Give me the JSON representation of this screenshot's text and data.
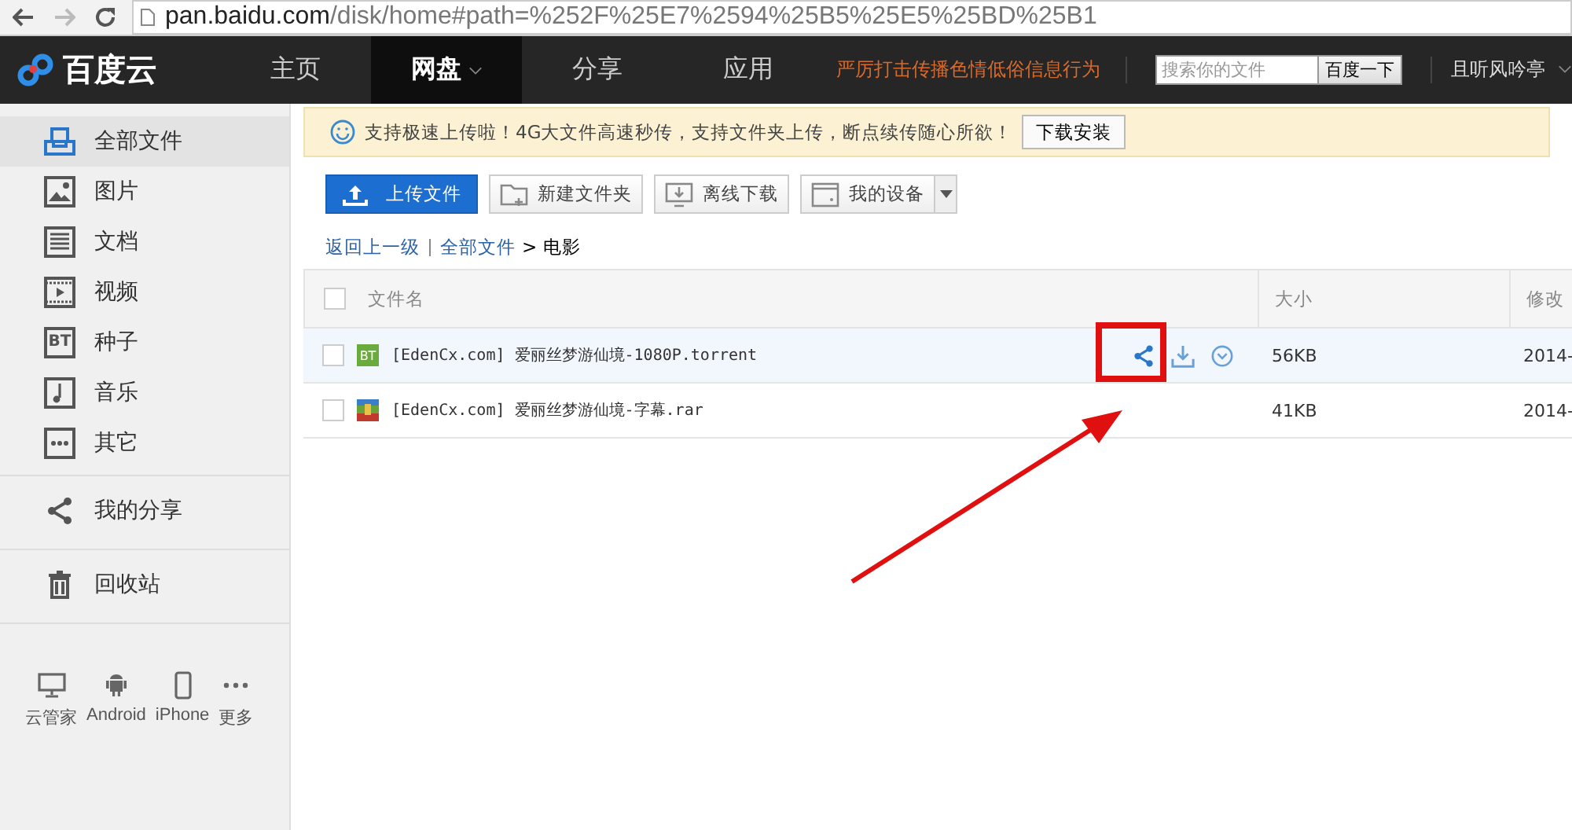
{
  "browser": {
    "url_host": "pan.baidu.com",
    "url_rest": "/disk/home#path=%252F%25E7%2594%25B5%25E5%25BD%25B1"
  },
  "nav": {
    "logo": "百度云",
    "items": [
      {
        "label": "主页",
        "selected": false,
        "has_caret": false
      },
      {
        "label": "网盘",
        "selected": true,
        "has_caret": true
      },
      {
        "label": "分享",
        "selected": false,
        "has_caret": false
      },
      {
        "label": "应用",
        "selected": false,
        "has_caret": false
      }
    ],
    "notice": "严厉打击传播色情低俗信息行为",
    "search": {
      "placeholder": "搜索你的文件",
      "button": "百度一下"
    },
    "user": "且听风吟亭"
  },
  "sidebar": {
    "items": [
      {
        "kind": "all",
        "label": "全部文件",
        "selected": true
      },
      {
        "kind": "image",
        "label": "图片",
        "selected": false
      },
      {
        "kind": "doc",
        "label": "文档",
        "selected": false
      },
      {
        "kind": "video",
        "label": "视频",
        "selected": false
      },
      {
        "kind": "bt",
        "label": "种子",
        "selected": false,
        "icon_text": "BT"
      },
      {
        "kind": "music",
        "label": "音乐",
        "selected": false
      },
      {
        "kind": "other",
        "label": "其它",
        "selected": false
      }
    ],
    "extra": [
      {
        "kind": "share",
        "label": "我的分享"
      },
      {
        "kind": "trash",
        "label": "回收站"
      }
    ],
    "devices": [
      {
        "kind": "pc",
        "label": "云管家"
      },
      {
        "kind": "android",
        "label": "Android"
      },
      {
        "kind": "phone",
        "label": "iPhone"
      },
      {
        "kind": "more",
        "label": "更多"
      }
    ]
  },
  "banner": {
    "text": "支持极速上传啦！4G大文件高速秒传，支持文件夹上传，断点续传随心所欲！",
    "button": "下载安装"
  },
  "toolbar": [
    {
      "kind": "upload",
      "label": "上传文件"
    },
    {
      "kind": "folder",
      "label": "新建文件夹"
    },
    {
      "kind": "offline",
      "label": "离线下载"
    },
    {
      "kind": "device",
      "label": "我的设备"
    }
  ],
  "breadcrumb": {
    "back": "返回上一级",
    "root": "全部文件",
    "sep": ">",
    "current": "电影"
  },
  "table": {
    "select_all_checked": false,
    "columns": [
      "文件名",
      "大小",
      "修改"
    ],
    "rows": [
      {
        "kind": "bt",
        "icon_text": "BT",
        "name": "[EdenCx.com] 爱丽丝梦游仙境-1080P.torrent",
        "size": "56KB",
        "date": "2014-",
        "hovered": true,
        "checked": false
      },
      {
        "kind": "rar",
        "name": "[EdenCx.com] 爱丽丝梦游仙境-字幕.rar",
        "size": "41KB",
        "date": "2014-",
        "hovered": false,
        "checked": false
      }
    ]
  }
}
